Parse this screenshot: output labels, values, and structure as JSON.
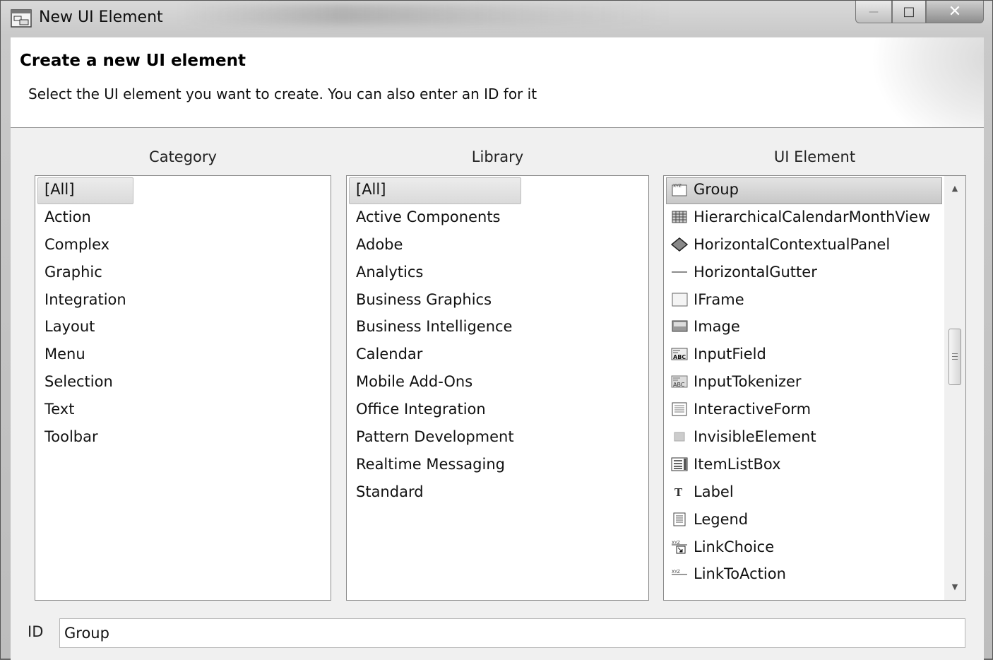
{
  "window": {
    "title": "New UI Element",
    "controls": {
      "minimize": "—",
      "maximize": "□",
      "close": "✕"
    }
  },
  "header": {
    "title": "Create a new UI element",
    "subtitle": "Select the UI element you want to create. You can also enter an ID for it"
  },
  "category": {
    "label": "Category",
    "items": [
      "[All]",
      "Action",
      "Complex",
      "Graphic",
      "Integration",
      "Layout",
      "Menu",
      "Selection",
      "Text",
      "Toolbar"
    ],
    "selected": "[All]"
  },
  "library": {
    "label": "Library",
    "items": [
      "[All]",
      "Active Components",
      "Adobe",
      "Analytics",
      "Business Graphics",
      "Business Intelligence",
      "Calendar",
      "Mobile Add-Ons",
      "Office Integration",
      "Pattern Development",
      "Realtime Messaging",
      "Standard"
    ],
    "selected": "[All]"
  },
  "ui_element": {
    "label": "UI Element",
    "items": [
      {
        "label": "Group",
        "icon": "group-icon"
      },
      {
        "label": "HierarchicalCalendarMonthView",
        "icon": "calendar-grid-icon"
      },
      {
        "label": "HorizontalContextualPanel",
        "icon": "diamond-icon"
      },
      {
        "label": "HorizontalGutter",
        "icon": "horizontal-line-icon"
      },
      {
        "label": "IFrame",
        "icon": "frame-icon"
      },
      {
        "label": "Image",
        "icon": "image-icon"
      },
      {
        "label": "InputField",
        "icon": "input-field-icon"
      },
      {
        "label": "InputTokenizer",
        "icon": "input-tokenizer-icon"
      },
      {
        "label": "InteractiveForm",
        "icon": "form-icon"
      },
      {
        "label": "InvisibleElement",
        "icon": "invisible-element-icon"
      },
      {
        "label": "ItemListBox",
        "icon": "list-box-icon"
      },
      {
        "label": "Label",
        "icon": "label-t-icon"
      },
      {
        "label": "Legend",
        "icon": "legend-icon"
      },
      {
        "label": "LinkChoice",
        "icon": "link-choice-icon"
      },
      {
        "label": "LinkToAction",
        "icon": "link-to-action-icon"
      }
    ],
    "selected": "Group"
  },
  "id_field": {
    "label": "ID",
    "value": "Group"
  }
}
